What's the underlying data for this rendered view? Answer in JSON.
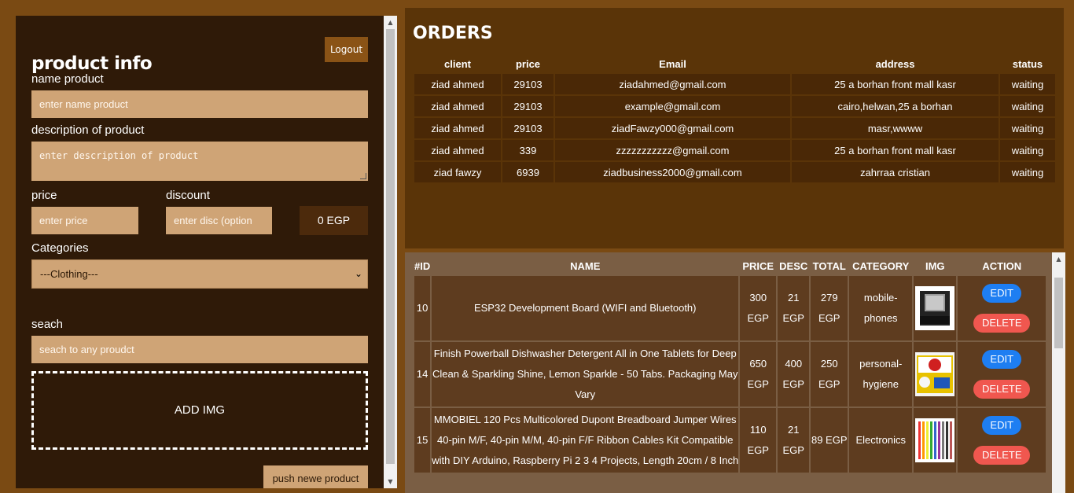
{
  "form": {
    "title": "product info",
    "logout_label": "Logout",
    "name_label": "name product",
    "name_placeholder": "enter name product",
    "desc_label": "description of product",
    "desc_placeholder": "enter description of product",
    "price_label": "price",
    "price_placeholder": "enter price",
    "discount_label": "discount",
    "discount_placeholder": "enter disc (option",
    "total_display": "0 EGP",
    "categories_label": "Categories",
    "category_selected": "---Clothing---",
    "search_label": "seach",
    "search_placeholder": "seach to any proudct",
    "add_img_label": "ADD IMG",
    "push_label": "push newe product"
  },
  "orders": {
    "title": "ORDERS",
    "headers": [
      "client",
      "price",
      "Email",
      "address",
      "status"
    ],
    "rows": [
      [
        "ziad ahmed",
        "29103",
        "ziadahmed@gmail.com",
        "25 a borhan front mall kasr",
        "waiting"
      ],
      [
        "ziad ahmed",
        "29103",
        "example@gmail.com",
        "cairo,helwan,25 a borhan",
        "waiting"
      ],
      [
        "ziad ahmed",
        "29103",
        "ziadFawzy000@gmail.com",
        "masr,wwww",
        "waiting"
      ],
      [
        "ziad ahmed",
        "339",
        "zzzzzzzzzzz@gmail.com",
        "25 a borhan front mall kasr",
        "waiting"
      ],
      [
        "ziad fawzy",
        "6939",
        "ziadbusiness2000@gmail.com",
        "zahrraa cristian",
        "waiting"
      ]
    ]
  },
  "products": {
    "headers": [
      "#ID",
      "NAME",
      "PRICE",
      "DESC",
      "TOTAL",
      "CATEGORY",
      "IMG",
      "ACTION"
    ],
    "edit_label": "EDIT",
    "delete_label": "DELETE",
    "rows": [
      {
        "id": "10",
        "name": "ESP32 Development Board (WIFI and Bluetooth)",
        "price": "300 EGP",
        "desc": "21 EGP",
        "total": "279 EGP",
        "category": "mobile-phones"
      },
      {
        "id": "14",
        "name": "Finish Powerball Dishwasher Detergent All in One Tablets for Deep Clean & Sparkling Shine, Lemon Sparkle - 50 Tabs. Packaging May Vary",
        "price": "650 EGP",
        "desc": "400 EGP",
        "total": "250 EGP",
        "category": "personal-hygiene"
      },
      {
        "id": "15",
        "name": "MMOBIEL 120 Pcs Multicolored Dupont Breadboard Jumper Wires 40-pin M/F, 40-pin M/M, 40-pin F/F Ribbon Cables Kit Compatible with DIY Arduino, Raspberry Pi 2 3 4 Projects, Length 20cm / 8 Inch",
        "price": "110 EGP",
        "desc": "21 EGP",
        "total": "89 EGP",
        "category": "Electronics"
      }
    ]
  }
}
